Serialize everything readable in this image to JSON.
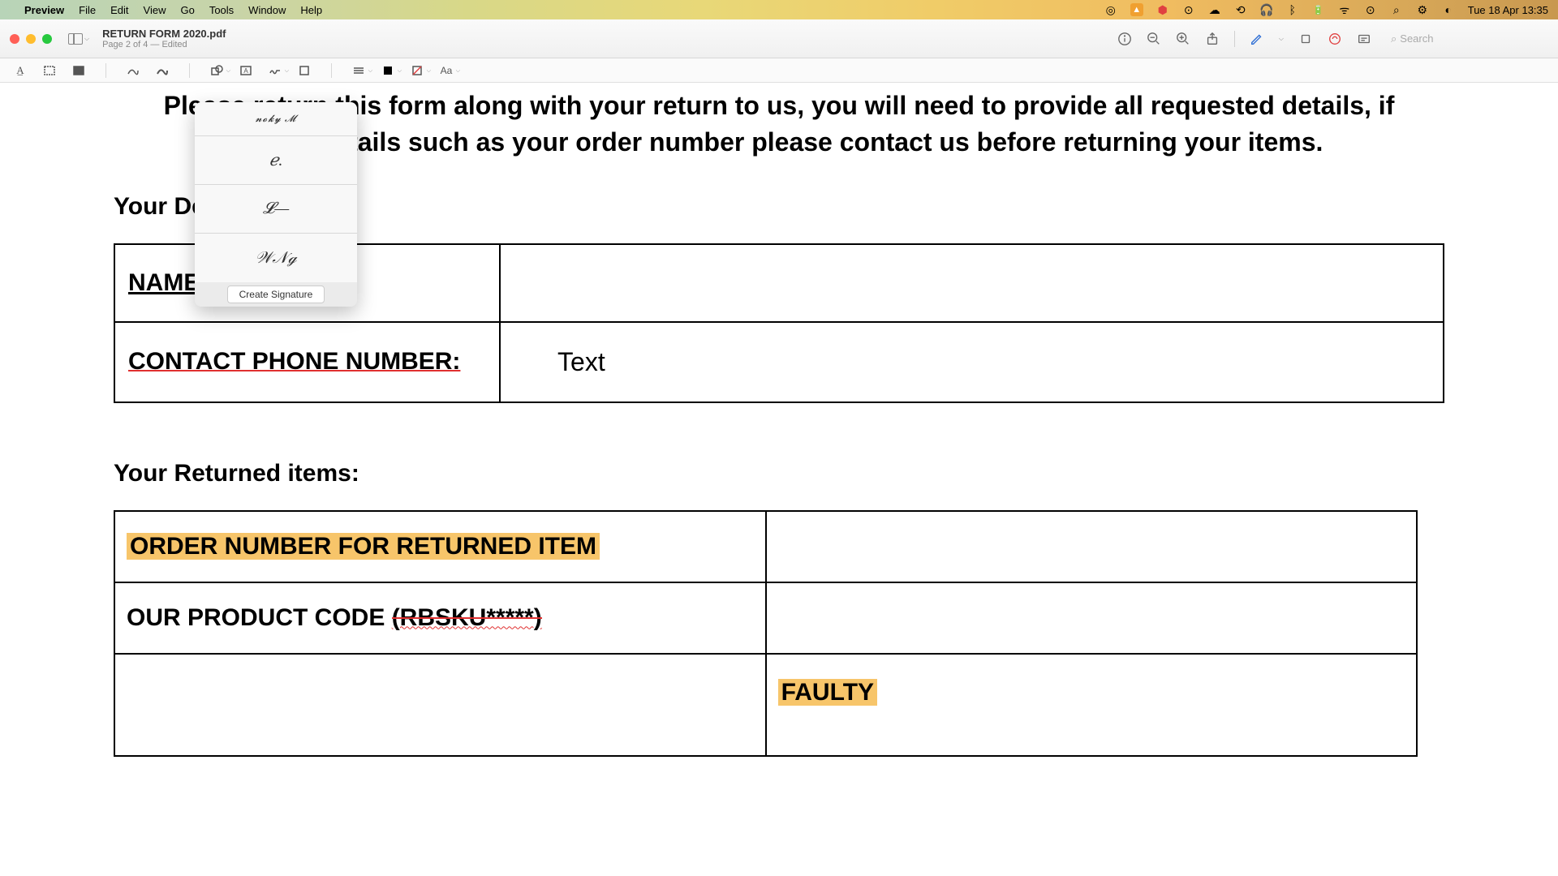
{
  "menubar": {
    "app": "Preview",
    "items": [
      "File",
      "Edit",
      "View",
      "Go",
      "Tools",
      "Window",
      "Help"
    ],
    "clock": "Tue 18 Apr 13:35"
  },
  "window": {
    "title": "RETURN FORM 2020.pdf",
    "subtitle": "Page 2 of 4 — Edited"
  },
  "search": {
    "placeholder": "Search"
  },
  "signature_popover": {
    "create_label": "Create Signature"
  },
  "document": {
    "header_line1": "Please return this form along with your return to us, you will need to provide all requested details, if",
    "header_line2": "of any details such as your order number please contact us before returning your items.",
    "section_details": "Your Details:",
    "name_label": "NAME:",
    "phone_label": "CONTACT PHONE NUMBER:",
    "phone_value": "Text",
    "section_items": "Your Returned items:",
    "order_number_label": "ORDER NUMBER FOR RETURNED ITEM",
    "product_code_prefix": "OUR PRODUCT CODE ",
    "product_code_suffix": "(RBSKU*****)",
    "faulty_label": "FAULTY"
  }
}
